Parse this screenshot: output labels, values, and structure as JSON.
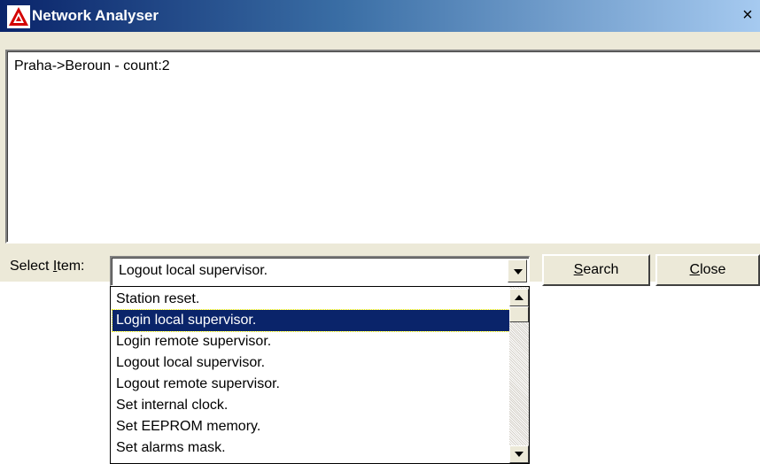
{
  "window": {
    "title": "Network Analyser",
    "close_glyph": "×",
    "icon": "warning-triangle-icon"
  },
  "output": {
    "lines": [
      "Praha->Beroun - count:2"
    ]
  },
  "controls": {
    "select_label_prefix": "Select ",
    "select_label_mnemonic": "I",
    "select_label_suffix": "tem:",
    "combo_value": "Logout local supervisor.",
    "search_mnemonic": "S",
    "search_rest": "earch",
    "close_mnemonic": "C",
    "close_rest": "lose"
  },
  "dropdown": {
    "items": [
      "Station reset.",
      "Login local supervisor.",
      "Login remote supervisor.",
      "Logout local supervisor.",
      "Logout remote supervisor.",
      "Set internal clock.",
      "Set EEPROM memory.",
      "Set alarms mask."
    ],
    "selected_index": 1
  },
  "colors": {
    "selection_bg": "#0a246a",
    "title_gradient_start": "#0a246a",
    "window_bg": "#ece9d8"
  }
}
